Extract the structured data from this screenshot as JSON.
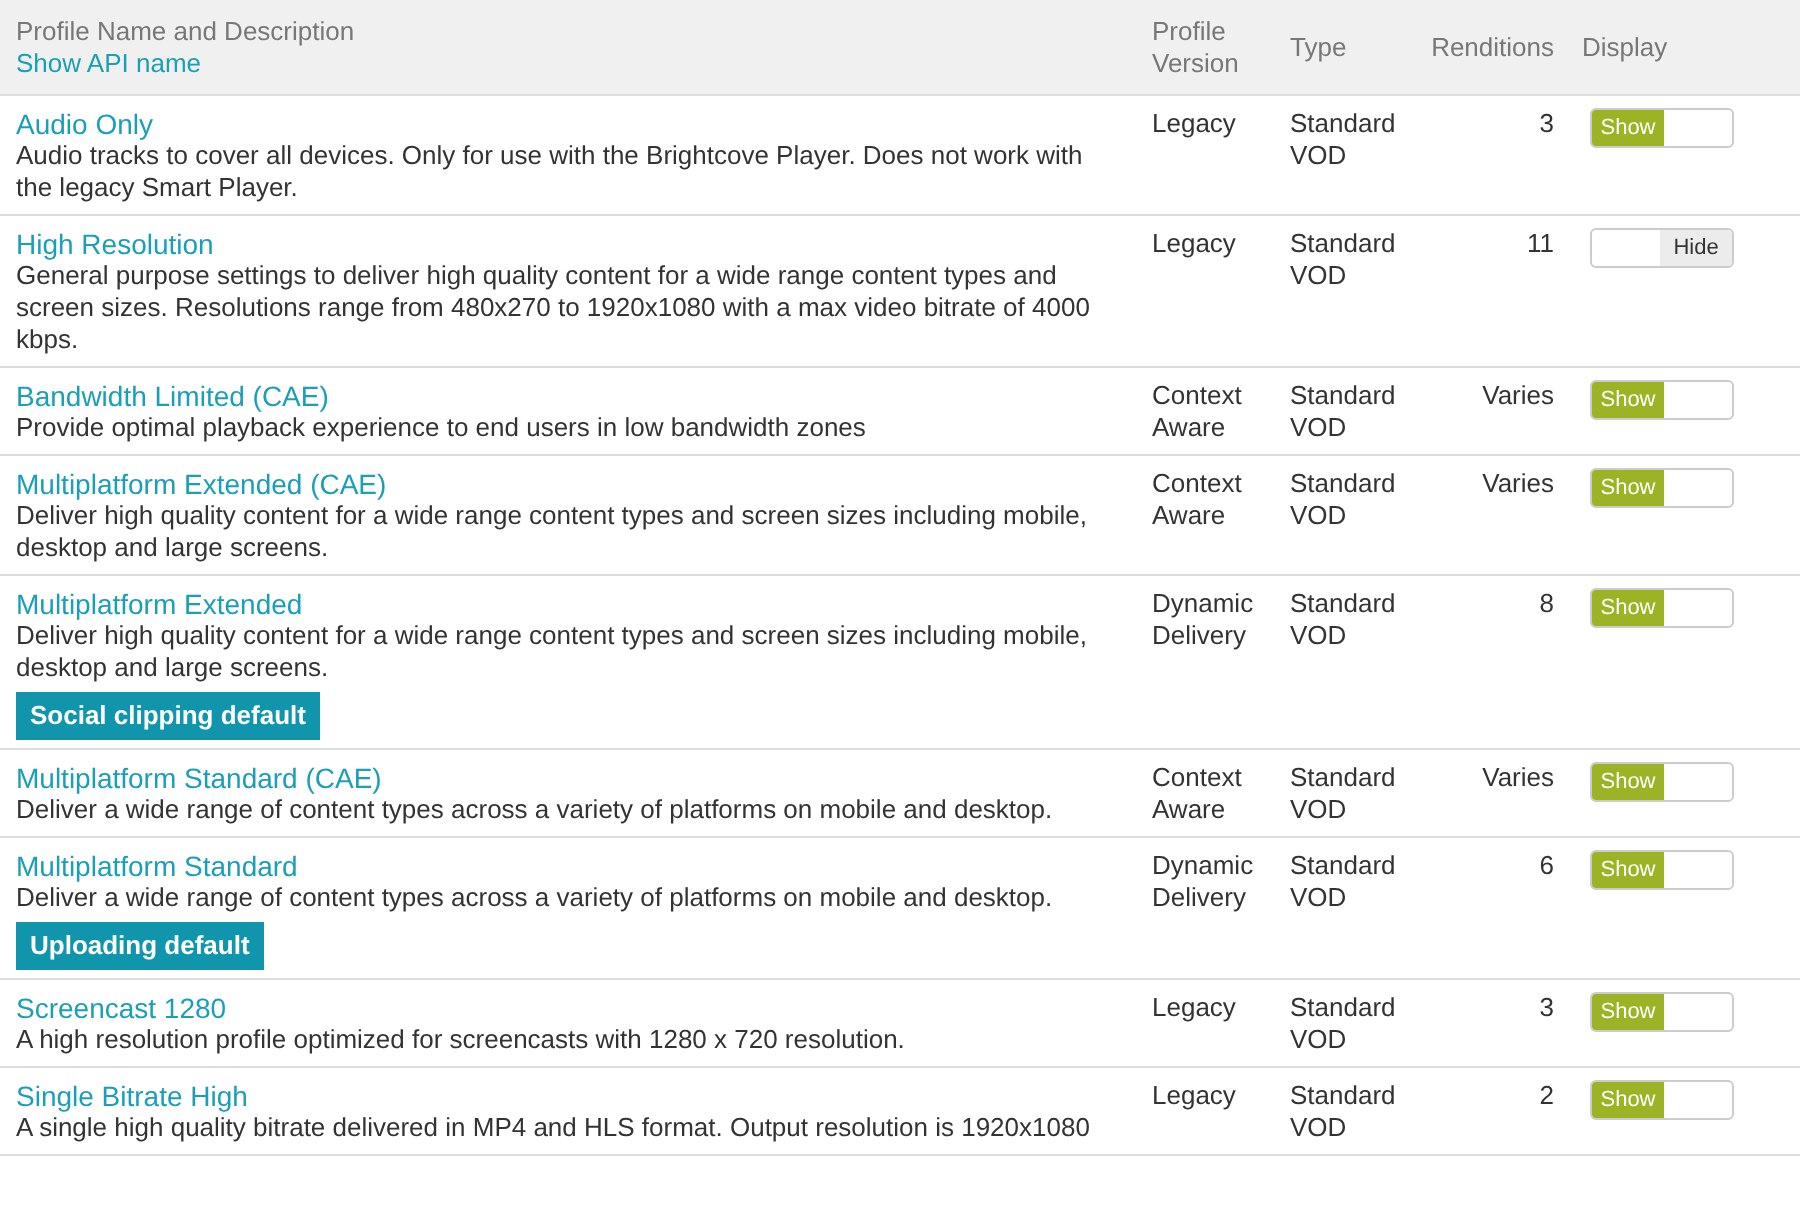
{
  "table": {
    "columns": [
      {
        "label": "Profile Name and Description",
        "link": "Show API name"
      },
      {
        "label": "Profile Version"
      },
      {
        "label": "Type"
      },
      {
        "label": "Renditions"
      },
      {
        "label": "Display"
      }
    ],
    "rows": [
      {
        "name": "Audio Only",
        "description": "Audio tracks to cover all devices. Only for use with the Brightcove Player. Does not work with the legacy Smart Player.",
        "version": "Legacy",
        "type": "Standard VOD",
        "renditions": "3",
        "display": {
          "on": true,
          "label": "Show"
        }
      },
      {
        "name": "High Resolution",
        "description": "General purpose settings to deliver high quality content for a wide range content types and screen sizes. Resolutions range from 480x270 to 1920x1080 with a max video bitrate of 4000 kbps.",
        "version": "Legacy",
        "type": "Standard VOD",
        "renditions": "11",
        "display": {
          "on": false,
          "label": "Hide"
        }
      },
      {
        "name": "Bandwidth Limited (CAE)",
        "description": "Provide optimal playback experience to end users in low bandwidth zones",
        "version": "Context Aware",
        "type": "Standard VOD",
        "renditions": "Varies",
        "display": {
          "on": true,
          "label": "Show"
        }
      },
      {
        "name": "Multiplatform Extended (CAE)",
        "description": "Deliver high quality content for a wide range content types and screen sizes including mobile, desktop and large screens.",
        "version": "Context Aware",
        "type": "Standard VOD",
        "renditions": "Varies",
        "display": {
          "on": true,
          "label": "Show"
        }
      },
      {
        "name": "Multiplatform Extended",
        "description": "Deliver high quality content for a wide range content types and screen sizes including mobile, desktop and large screens.",
        "badge": "Social clipping default",
        "version": "Dynamic Delivery",
        "type": "Standard VOD",
        "renditions": "8",
        "display": {
          "on": true,
          "label": "Show"
        }
      },
      {
        "name": "Multiplatform Standard (CAE)",
        "description": "Deliver a wide range of content types across a variety of platforms on mobile and desktop.",
        "version": "Context Aware",
        "type": "Standard VOD",
        "renditions": "Varies",
        "display": {
          "on": true,
          "label": "Show"
        }
      },
      {
        "name": "Multiplatform Standard",
        "description": "Deliver a wide range of content types across a variety of platforms on mobile and desktop.",
        "badge": "Uploading default",
        "version": "Dynamic Delivery",
        "type": "Standard VOD",
        "renditions": "6",
        "display": {
          "on": true,
          "label": "Show"
        }
      },
      {
        "name": "Screencast 1280",
        "description": "A high resolution profile optimized for screencasts with 1280 x 720 resolution.",
        "version": "Legacy",
        "type": "Standard VOD",
        "renditions": "3",
        "display": {
          "on": true,
          "label": "Show"
        }
      },
      {
        "name": "Single Bitrate High",
        "description": "A single high quality bitrate delivered in MP4 and HLS format. Output resolution is 1920x1080",
        "version": "Legacy",
        "type": "Standard VOD",
        "renditions": "2",
        "display": {
          "on": true,
          "label": "Show"
        }
      }
    ]
  }
}
